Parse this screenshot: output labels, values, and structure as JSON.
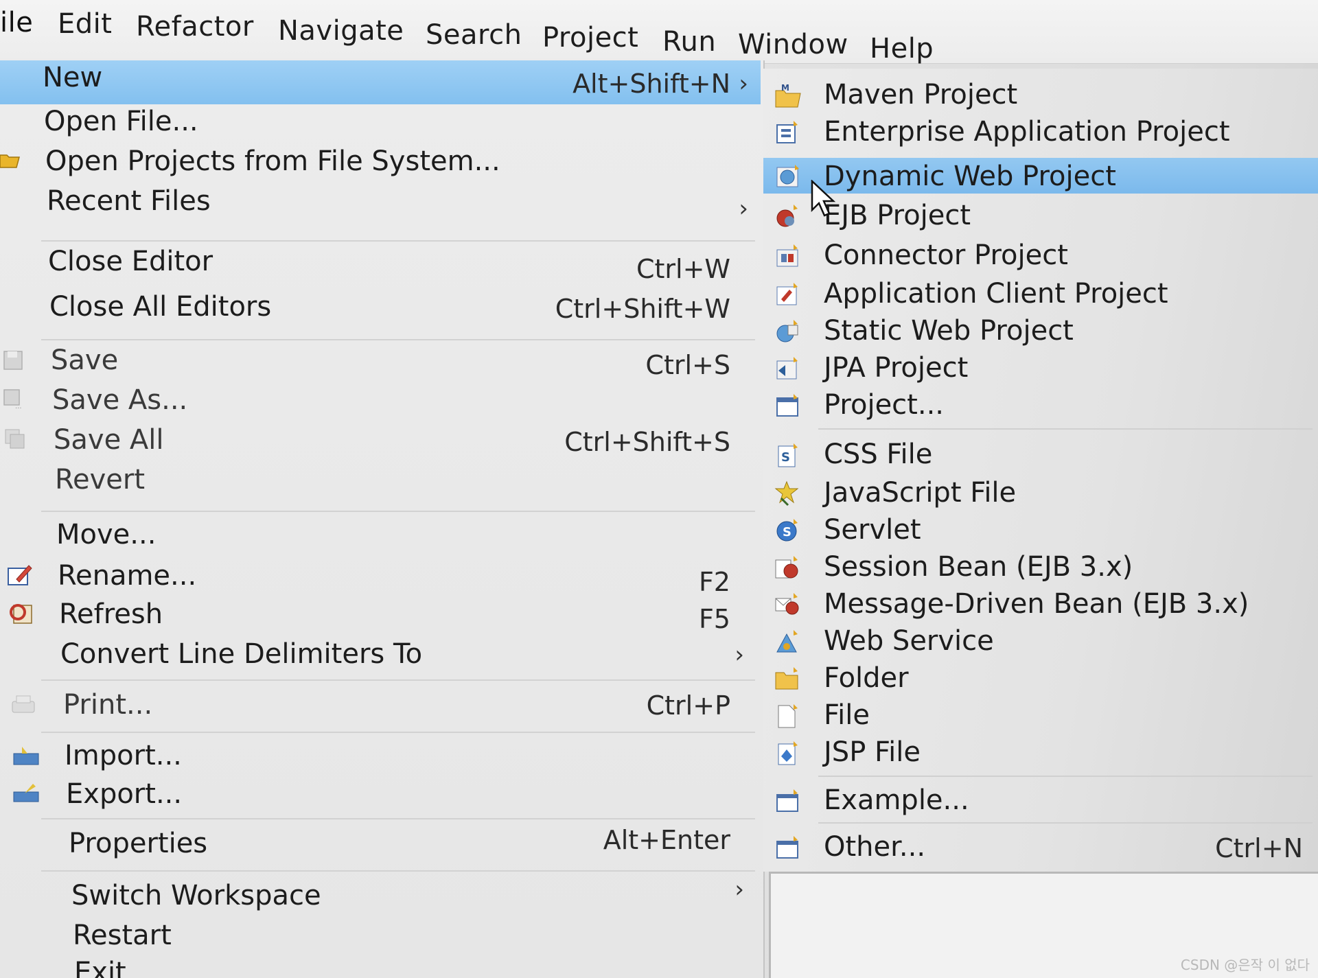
{
  "menubar": {
    "items": [
      "ile",
      "Edit",
      "Refactor",
      "Navigate",
      "Search",
      "Project",
      "Run",
      "Window",
      "Help"
    ]
  },
  "file_menu": {
    "items": [
      {
        "label": "New",
        "shortcut": "Alt+Shift+N",
        "submenu": true,
        "highlighted": true
      },
      {
        "label": "Open File...",
        "shortcut": ""
      },
      {
        "label": "Open Projects from File System...",
        "shortcut": "",
        "icon": "folder-open-icon"
      },
      {
        "label": "Recent Files",
        "shortcut": "",
        "submenu": true
      },
      {
        "label": "Close Editor",
        "shortcut": "Ctrl+W"
      },
      {
        "label": "Close All Editors",
        "shortcut": "Ctrl+Shift+W"
      },
      {
        "label": "Save",
        "shortcut": "Ctrl+S",
        "icon": "save-icon",
        "disabled": true
      },
      {
        "label": "Save As...",
        "shortcut": "",
        "icon": "save-as-icon",
        "disabled": true
      },
      {
        "label": "Save All",
        "shortcut": "Ctrl+Shift+S",
        "icon": "save-all-icon",
        "disabled": true
      },
      {
        "label": "Revert",
        "shortcut": "",
        "disabled": true
      },
      {
        "label": "Move...",
        "shortcut": ""
      },
      {
        "label": "Rename...",
        "shortcut": "F2",
        "icon": "rename-icon"
      },
      {
        "label": "Refresh",
        "shortcut": "F5",
        "icon": "refresh-icon"
      },
      {
        "label": "Convert Line Delimiters To",
        "shortcut": "",
        "submenu": true
      },
      {
        "label": "Print...",
        "shortcut": "Ctrl+P",
        "icon": "print-icon",
        "disabled": true
      },
      {
        "label": "Import...",
        "shortcut": "",
        "icon": "import-icon"
      },
      {
        "label": "Export...",
        "shortcut": "",
        "icon": "export-icon"
      },
      {
        "label": "Properties",
        "shortcut": "Alt+Enter"
      },
      {
        "label": "Switch Workspace",
        "shortcut": "",
        "submenu": true
      },
      {
        "label": "Restart",
        "shortcut": ""
      },
      {
        "label": "Exit",
        "shortcut": ""
      }
    ]
  },
  "new_submenu": {
    "items": [
      {
        "label": "Maven Project",
        "icon": "maven-project-icon"
      },
      {
        "label": "Enterprise Application Project",
        "icon": "enterprise-app-project-icon"
      },
      {
        "label": "Dynamic Web Project",
        "icon": "dynamic-web-project-icon",
        "highlighted": true
      },
      {
        "label": "EJB Project",
        "icon": "ejb-project-icon"
      },
      {
        "label": "Connector Project",
        "icon": "connector-project-icon"
      },
      {
        "label": "Application Client Project",
        "icon": "app-client-project-icon"
      },
      {
        "label": "Static Web Project",
        "icon": "static-web-project-icon"
      },
      {
        "label": "JPA Project",
        "icon": "jpa-project-icon"
      },
      {
        "label": "Project...",
        "icon": "project-icon"
      },
      {
        "label": "CSS File",
        "icon": "css-file-icon"
      },
      {
        "label": "JavaScript File",
        "icon": "javascript-file-icon"
      },
      {
        "label": "Servlet",
        "icon": "servlet-icon"
      },
      {
        "label": "Session Bean (EJB 3.x)",
        "icon": "session-bean-icon"
      },
      {
        "label": "Message-Driven Bean (EJB 3.x)",
        "icon": "message-driven-bean-icon"
      },
      {
        "label": "Web Service",
        "icon": "web-service-icon"
      },
      {
        "label": "Folder",
        "icon": "folder-icon"
      },
      {
        "label": "File",
        "icon": "file-icon"
      },
      {
        "label": "JSP File",
        "icon": "jsp-file-icon"
      },
      {
        "label": "Example...",
        "icon": "example-icon"
      },
      {
        "label": "Other...",
        "icon": "other-icon",
        "shortcut": "Ctrl+N"
      }
    ]
  },
  "watermark": "CSDN @은작 이 없다",
  "colors": {
    "highlight": "#8fc6f1",
    "menu_bg": "#e8e8e8"
  }
}
